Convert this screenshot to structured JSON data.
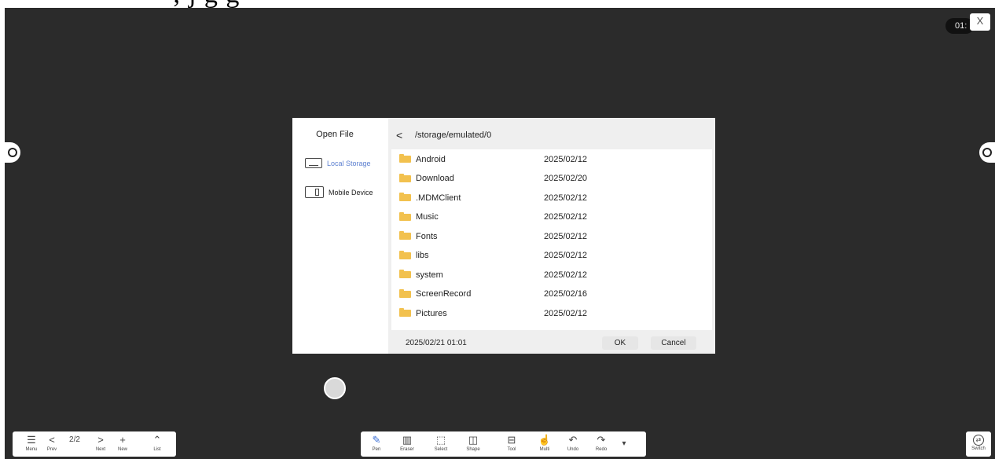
{
  "top_strip_text": "; j g g",
  "clock_pill": "01:",
  "close_label": "X",
  "dialog": {
    "title": "Open File",
    "sources": [
      {
        "label": "Local Storage"
      },
      {
        "label": "Mobile Device"
      }
    ],
    "back_glyph": "<",
    "path": "/storage/emulated/0",
    "files": [
      {
        "name": "Android",
        "date": "2025/02/12"
      },
      {
        "name": "Download",
        "date": "2025/02/20"
      },
      {
        "name": ".MDMClient",
        "date": "2025/02/12"
      },
      {
        "name": "Music",
        "date": "2025/02/12"
      },
      {
        "name": "Fonts",
        "date": "2025/02/12"
      },
      {
        "name": "libs",
        "date": "2025/02/12"
      },
      {
        "name": "system",
        "date": "2025/02/12"
      },
      {
        "name": "ScreenRecord",
        "date": "2025/02/16"
      },
      {
        "name": "Pictures",
        "date": "2025/02/12"
      }
    ],
    "footer_datetime": "2025/02/21 01:01",
    "ok_label": "OK",
    "cancel_label": "Cancel"
  },
  "toolbar_left": {
    "page_indicator": "2/2",
    "items": [
      {
        "label": "Menu",
        "icon": "menu-icon",
        "glyph": "☰"
      },
      {
        "label": "Prev",
        "icon": "chevron-left-icon",
        "glyph": "<"
      },
      {
        "label": "Next",
        "icon": "chevron-right-icon",
        "glyph": ">"
      },
      {
        "label": "New",
        "icon": "plus-box-icon",
        "glyph": "+"
      },
      {
        "label": "List",
        "icon": "chevron-up-circle-icon",
        "glyph": "⌃"
      }
    ]
  },
  "toolbar_main": {
    "items": [
      {
        "label": "Pen",
        "icon": "pen-icon",
        "glyph": "✎"
      },
      {
        "label": "Eraser",
        "icon": "eraser-icon",
        "glyph": "▥"
      },
      {
        "label": "Select",
        "icon": "select-icon",
        "glyph": "⬚"
      },
      {
        "label": "Shape",
        "icon": "shape-icon",
        "glyph": "◫"
      },
      {
        "label": "Tool",
        "icon": "toolbox-icon",
        "glyph": "⊟"
      },
      {
        "label": "Multi",
        "icon": "hand-icon",
        "glyph": "☝"
      },
      {
        "label": "Undo",
        "icon": "undo-icon",
        "glyph": "↶"
      },
      {
        "label": "Redo",
        "icon": "redo-icon",
        "glyph": "↷"
      }
    ],
    "expand_glyph": "▾"
  },
  "switch_button": {
    "label": "Switch",
    "glyph": "⇄"
  },
  "colors": {
    "board": "#2b2b2b",
    "folder": "#f2c14e",
    "accent": "#5b7fd0",
    "pen_active": "#3b6fd6"
  }
}
